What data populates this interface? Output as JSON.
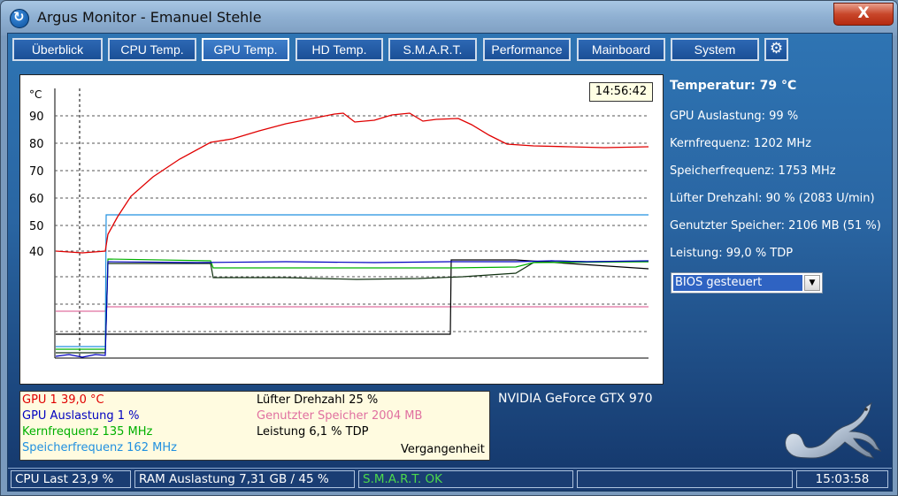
{
  "window": {
    "title": "Argus Monitor - Emanuel Stehle",
    "close_symbol": "X"
  },
  "tabs": [
    {
      "label": "Überblick",
      "active": false
    },
    {
      "label": "CPU Temp.",
      "active": false
    },
    {
      "label": "GPU Temp.",
      "active": true
    },
    {
      "label": "HD Temp.",
      "active": false
    },
    {
      "label": "S.M.A.R.T.",
      "active": false
    },
    {
      "label": "Performance",
      "active": false
    },
    {
      "label": "Mainboard",
      "active": false
    },
    {
      "label": "System",
      "active": false
    }
  ],
  "settings_icon": "gear-icon",
  "graph": {
    "unit": "°C",
    "time": "14:56:42",
    "ticks": [
      "90",
      "80",
      "70",
      "60",
      "50",
      "40"
    ],
    "chart_data": {
      "type": "line",
      "ylabel": "°C",
      "y_ticks": [
        90,
        80,
        70,
        60,
        50,
        40
      ],
      "grid": true,
      "series": [
        {
          "name": "GPU 1",
          "color": "#e00000"
        },
        {
          "name": "GPU Auslastung",
          "color": "#0000c0"
        },
        {
          "name": "Kernfrequenz",
          "color": "#00b000"
        },
        {
          "name": "Speicherfrequenz",
          "color": "#2090e0"
        },
        {
          "name": "Lüfter Drehzahl",
          "color": "#000000"
        },
        {
          "name": "Genutzter Speicher",
          "color": "#e070a0"
        },
        {
          "name": "Leistung",
          "color": "#103010"
        }
      ]
    }
  },
  "info": {
    "temperature": "Temperatur: 79 °C",
    "gpu_load": "GPU Auslastung: 99 %",
    "core_clock": "Kernfrequenz: 1202 MHz",
    "mem_clock": "Speicherfrequenz: 1753 MHz",
    "fan": "Lüfter Drehzahl: 90 % (2083 U/min)",
    "memory": "Genutzter Speicher: 2106 MB (51 %)",
    "power": "Leistung: 99,0 % TDP"
  },
  "fan_control": {
    "value": "BIOS gesteuert"
  },
  "legend": {
    "gpu1": "GPU 1  39,0 °C",
    "gpu_load": "GPU Auslastung  1 %",
    "core_clock": "Kernfrequenz  135 MHz",
    "mem_clock": "Speicherfrequenz  162 MHz",
    "fan": "Lüfter Drehzahl  25 %",
    "memory": "Genutzter Speicher  2004 MB",
    "power": "Leistung  6,1 % TDP",
    "history": "Vergangenheit",
    "colors": {
      "gpu1": "#e00000",
      "gpu_load": "#0000c0",
      "core_clock": "#00b000",
      "mem_clock": "#2090e0",
      "fan": "#000000",
      "memory": "#e070a0",
      "power": "#000000"
    }
  },
  "gpu_name": "NVIDIA GeForce GTX 970",
  "statusbar": {
    "cpu": "CPU Last 23,9 %",
    "ram": "RAM Auslastung 7,31 GB / 45 %",
    "smart": "S.M.A.R.T. OK",
    "empty": "",
    "clock": "15:03:58",
    "smart_color": "#4cd84c"
  }
}
